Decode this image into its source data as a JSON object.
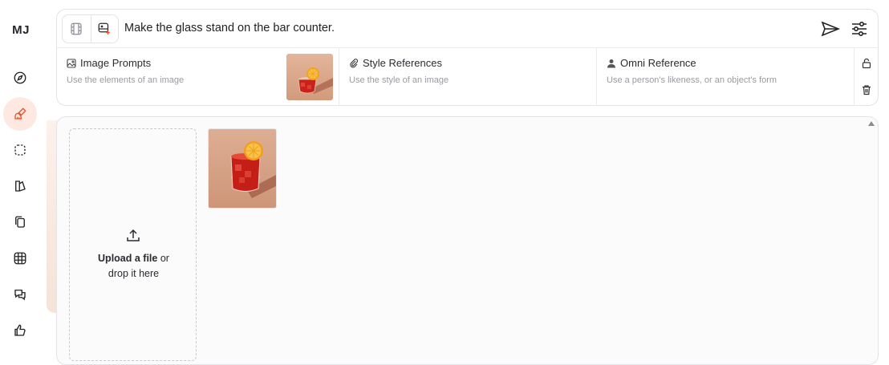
{
  "app": {
    "logo": "MJ"
  },
  "sidebar": {
    "items": [
      {
        "icon": "compass-icon",
        "active": false
      },
      {
        "icon": "brush-icon",
        "active": true
      },
      {
        "icon": "selection-icon",
        "active": false
      },
      {
        "icon": "folder-edit-icon",
        "active": false
      },
      {
        "icon": "copy-icon",
        "active": false
      },
      {
        "icon": "grid-icon",
        "active": false
      },
      {
        "icon": "chat-icon",
        "active": false
      },
      {
        "icon": "thumbs-up-icon",
        "active": false
      }
    ],
    "accent_color": "#e8542f"
  },
  "prompt": {
    "text": "Make the glass stand on the bar counter."
  },
  "references": {
    "image_prompts": {
      "title": "Image Prompts",
      "subtitle": "Use the elements of an image"
    },
    "style_references": {
      "title": "Style References",
      "subtitle": "Use the style of an image"
    },
    "omni_reference": {
      "title": "Omni Reference",
      "subtitle": "Use a person's likeness, or an object's form"
    }
  },
  "upload": {
    "line1_bold": "Upload a file",
    "line1_rest": " or",
    "line2": "drop it here"
  }
}
